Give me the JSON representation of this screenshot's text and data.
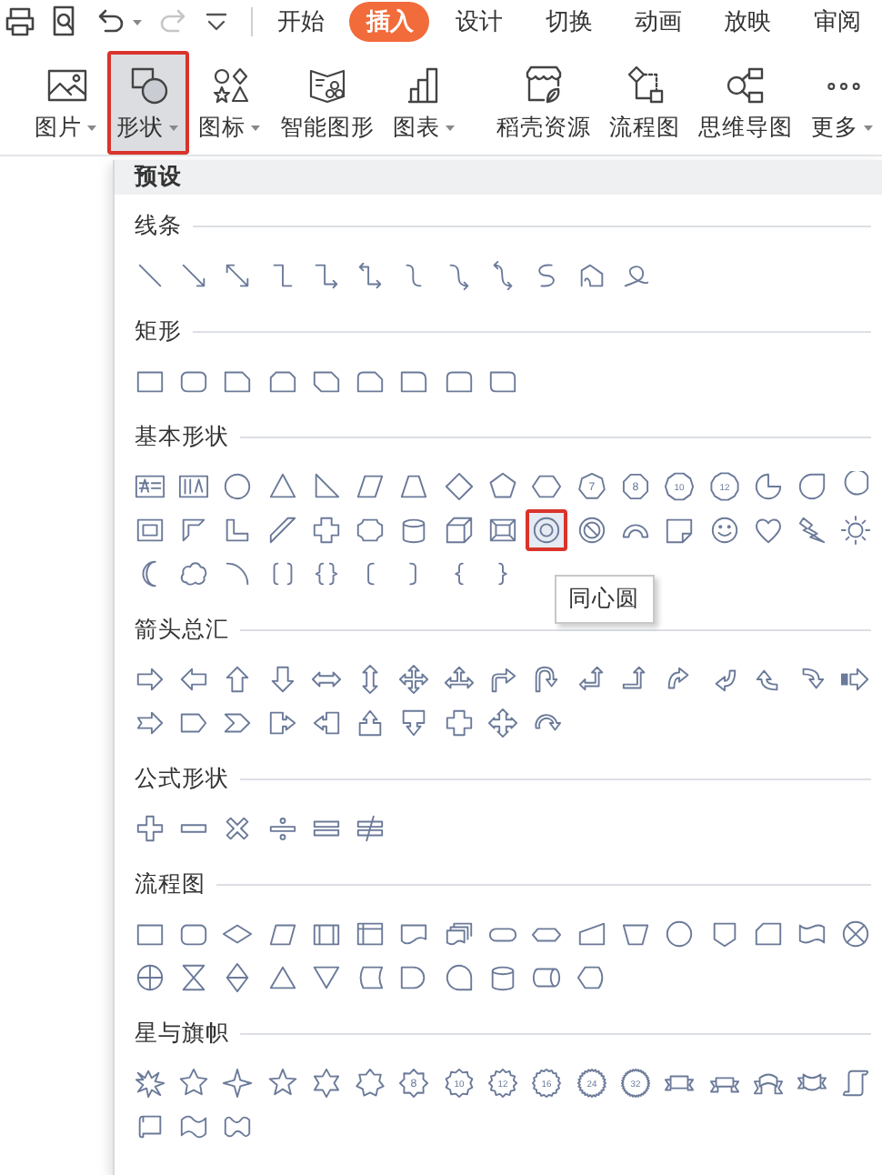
{
  "quick_access": [
    {
      "kind": "print",
      "dropdown": false,
      "disabled": false
    },
    {
      "kind": "print-preview",
      "dropdown": false,
      "disabled": false
    },
    {
      "kind": "undo",
      "dropdown": true,
      "disabled": false
    },
    {
      "kind": "redo",
      "dropdown": false,
      "disabled": true
    },
    {
      "kind": "customize",
      "dropdown": false,
      "disabled": false
    }
  ],
  "tabs": [
    {
      "label": "开始",
      "selected": false
    },
    {
      "label": "插入",
      "selected": true
    },
    {
      "label": "设计",
      "selected": false
    },
    {
      "label": "切换",
      "selected": false
    },
    {
      "label": "动画",
      "selected": false
    },
    {
      "label": "放映",
      "selected": false
    },
    {
      "label": "审阅",
      "selected": false
    }
  ],
  "ribbon": [
    {
      "kind": "picture",
      "label": "图片",
      "dropdown": true,
      "selected": false
    },
    {
      "kind": "shapes",
      "label": "形状",
      "dropdown": true,
      "selected": true
    },
    {
      "kind": "icons",
      "label": "图标",
      "dropdown": true,
      "selected": false
    },
    {
      "kind": "smart-art",
      "label": "智能图形",
      "dropdown": false,
      "selected": false
    },
    {
      "kind": "chart",
      "label": "图表",
      "dropdown": true,
      "selected": false
    },
    {
      "kind": "separator"
    },
    {
      "kind": "store",
      "label": "稻壳资源",
      "dropdown": false,
      "selected": false
    },
    {
      "kind": "flowchart",
      "label": "流程图",
      "dropdown": false,
      "selected": false
    },
    {
      "kind": "mindmap",
      "label": "思维导图",
      "dropdown": false,
      "selected": false
    },
    {
      "kind": "more",
      "label": "更多",
      "dropdown": true,
      "selected": false
    }
  ],
  "gallery": {
    "header": "预设",
    "sections": [
      {
        "title": "线条",
        "shapes": [
          {
            "kind": "line",
            "selected": false
          },
          {
            "kind": "arrow",
            "selected": false
          },
          {
            "kind": "double-arrow",
            "selected": false
          },
          {
            "kind": "elbow-connector",
            "selected": false
          },
          {
            "kind": "elbow-arrow",
            "selected": false
          },
          {
            "kind": "elbow-double-arrow",
            "selected": false
          },
          {
            "kind": "curved-connector",
            "selected": false
          },
          {
            "kind": "curved-arrow",
            "selected": false
          },
          {
            "kind": "curved-double-arrow",
            "selected": false
          },
          {
            "kind": "s-curve",
            "selected": false
          },
          {
            "kind": "freeform",
            "selected": false
          },
          {
            "kind": "scribble",
            "selected": false
          }
        ]
      },
      {
        "title": "矩形",
        "shapes": [
          {
            "kind": "rectangle",
            "selected": false
          },
          {
            "kind": "rounded-rectangle",
            "selected": false
          },
          {
            "kind": "snip-corner",
            "selected": false
          },
          {
            "kind": "snip-same-side",
            "selected": false
          },
          {
            "kind": "snip-diagonal",
            "selected": false
          },
          {
            "kind": "snip-round",
            "selected": false
          },
          {
            "kind": "round-corner",
            "selected": false
          },
          {
            "kind": "round-same-side",
            "selected": false
          },
          {
            "kind": "round-diagonal",
            "selected": false
          }
        ]
      },
      {
        "title": "基本形状",
        "shapes": [
          {
            "kind": "text-box",
            "selected": false
          },
          {
            "kind": "vertical-text-box",
            "selected": false
          },
          {
            "kind": "ellipse",
            "selected": false
          },
          {
            "kind": "triangle",
            "selected": false
          },
          {
            "kind": "right-triangle",
            "selected": false
          },
          {
            "kind": "parallelogram",
            "selected": false
          },
          {
            "kind": "trapezoid",
            "selected": false
          },
          {
            "kind": "diamond",
            "selected": false
          },
          {
            "kind": "pentagon",
            "selected": false
          },
          {
            "kind": "hexagon",
            "selected": false
          },
          {
            "kind": "heptagon",
            "label": "7",
            "selected": false
          },
          {
            "kind": "octagon",
            "label": "8",
            "selected": false
          },
          {
            "kind": "decagon",
            "label": "10",
            "selected": false
          },
          {
            "kind": "dodecagon",
            "label": "12",
            "selected": false
          },
          {
            "kind": "pie",
            "selected": false
          },
          {
            "kind": "teardrop",
            "selected": false
          },
          {
            "kind": "chord",
            "selected": false
          },
          {
            "kind": "frame",
            "selected": false
          },
          {
            "kind": "half-frame",
            "selected": false
          },
          {
            "kind": "l-shape",
            "selected": false
          },
          {
            "kind": "diagonal-stripe",
            "selected": false
          },
          {
            "kind": "cross",
            "selected": false
          },
          {
            "kind": "plaque",
            "selected": false
          },
          {
            "kind": "cylinder",
            "selected": false
          },
          {
            "kind": "cube",
            "selected": false
          },
          {
            "kind": "bevel",
            "selected": false
          },
          {
            "kind": "donut",
            "selected": true
          },
          {
            "kind": "no-symbol",
            "selected": false
          },
          {
            "kind": "block-arc",
            "selected": false
          },
          {
            "kind": "folded-corner",
            "selected": false
          },
          {
            "kind": "smiley",
            "selected": false
          },
          {
            "kind": "heart",
            "selected": false
          },
          {
            "kind": "lightning",
            "selected": false
          },
          {
            "kind": "sun",
            "selected": false
          },
          {
            "kind": "moon",
            "selected": false
          },
          {
            "kind": "cloud",
            "selected": false
          },
          {
            "kind": "arc",
            "selected": false
          },
          {
            "kind": "bracket-pair",
            "selected": false
          },
          {
            "kind": "brace-pair",
            "selected": false
          },
          {
            "kind": "left-bracket",
            "selected": false
          },
          {
            "kind": "right-bracket",
            "selected": false
          },
          {
            "kind": "left-brace",
            "selected": false
          },
          {
            "kind": "right-brace",
            "selected": false
          }
        ]
      },
      {
        "title": "箭头总汇",
        "shapes": [
          {
            "kind": "right-arrow",
            "selected": false
          },
          {
            "kind": "left-arrow",
            "selected": false
          },
          {
            "kind": "up-arrow",
            "selected": false
          },
          {
            "kind": "down-arrow",
            "selected": false
          },
          {
            "kind": "left-right-arrow",
            "selected": false
          },
          {
            "kind": "up-down-arrow",
            "selected": false
          },
          {
            "kind": "quad-arrow",
            "selected": false
          },
          {
            "kind": "left-right-up-arrow",
            "selected": false
          },
          {
            "kind": "bent-arrow",
            "selected": false
          },
          {
            "kind": "u-turn-arrow",
            "selected": false
          },
          {
            "kind": "left-up-arrow",
            "selected": false
          },
          {
            "kind": "bent-up-arrow",
            "selected": false
          },
          {
            "kind": "curved-right-arrow",
            "selected": false
          },
          {
            "kind": "curved-left-arrow",
            "selected": false
          },
          {
            "kind": "curved-up-arrow",
            "selected": false
          },
          {
            "kind": "curved-down-arrow",
            "selected": false
          },
          {
            "kind": "striped-right-arrow",
            "selected": false
          },
          {
            "kind": "notched-right-arrow",
            "selected": false
          },
          {
            "kind": "pentagon-arrow",
            "selected": false
          },
          {
            "kind": "chevron",
            "selected": false
          },
          {
            "kind": "right-arrow-callout",
            "selected": false
          },
          {
            "kind": "left-arrow-callout",
            "selected": false
          },
          {
            "kind": "up-arrow-callout",
            "selected": false
          },
          {
            "kind": "down-arrow-callout",
            "selected": false
          },
          {
            "kind": "quad-arrow-callout",
            "selected": false
          },
          {
            "kind": "four-way-arrow",
            "selected": false
          },
          {
            "kind": "circular-arrow",
            "selected": false
          }
        ]
      },
      {
        "title": "公式形状",
        "shapes": [
          {
            "kind": "plus",
            "selected": false
          },
          {
            "kind": "minus",
            "selected": false
          },
          {
            "kind": "multiply",
            "selected": false
          },
          {
            "kind": "divide",
            "selected": false
          },
          {
            "kind": "equal",
            "selected": false
          },
          {
            "kind": "not-equal",
            "selected": false
          }
        ]
      },
      {
        "title": "流程图",
        "shapes": [
          {
            "kind": "process",
            "selected": false
          },
          {
            "kind": "alternate-process",
            "selected": false
          },
          {
            "kind": "decision",
            "selected": false
          },
          {
            "kind": "data",
            "selected": false
          },
          {
            "kind": "predefined-process",
            "selected": false
          },
          {
            "kind": "internal-storage",
            "selected": false
          },
          {
            "kind": "document",
            "selected": false
          },
          {
            "kind": "multi-document",
            "selected": false
          },
          {
            "kind": "terminator",
            "selected": false
          },
          {
            "kind": "preparation",
            "selected": false
          },
          {
            "kind": "manual-input",
            "selected": false
          },
          {
            "kind": "manual-operation",
            "selected": false
          },
          {
            "kind": "connector",
            "selected": false
          },
          {
            "kind": "off-page-connector",
            "selected": false
          },
          {
            "kind": "card",
            "selected": false
          },
          {
            "kind": "punched-tape",
            "selected": false
          },
          {
            "kind": "summing-junction",
            "selected": false
          },
          {
            "kind": "or",
            "selected": false
          },
          {
            "kind": "collate",
            "selected": false
          },
          {
            "kind": "sort",
            "selected": false
          },
          {
            "kind": "extract",
            "selected": false
          },
          {
            "kind": "merge",
            "selected": false
          },
          {
            "kind": "stored-data",
            "selected": false
          },
          {
            "kind": "delay",
            "selected": false
          },
          {
            "kind": "sequential-access",
            "selected": false
          },
          {
            "kind": "magnetic-disk",
            "selected": false
          },
          {
            "kind": "direct-access",
            "selected": false
          },
          {
            "kind": "display",
            "selected": false
          }
        ]
      },
      {
        "title": "星与旗帜",
        "shapes": [
          {
            "kind": "explosion",
            "selected": false
          },
          {
            "kind": "explosion-outline",
            "selected": false
          },
          {
            "kind": "star-4",
            "selected": false
          },
          {
            "kind": "star-5",
            "selected": false
          },
          {
            "kind": "star-6",
            "selected": false
          },
          {
            "kind": "star-7",
            "selected": false
          },
          {
            "kind": "star-8",
            "label": "8",
            "selected": false
          },
          {
            "kind": "star-10",
            "label": "10",
            "selected": false
          },
          {
            "kind": "star-12",
            "label": "12",
            "selected": false
          },
          {
            "kind": "star-16",
            "label": "16",
            "selected": false
          },
          {
            "kind": "star-24",
            "label": "24",
            "selected": false
          },
          {
            "kind": "star-32",
            "label": "32",
            "selected": false
          },
          {
            "kind": "ribbon-down",
            "selected": false
          },
          {
            "kind": "ribbon-up",
            "selected": false
          },
          {
            "kind": "curved-ribbon-down",
            "selected": false
          },
          {
            "kind": "curved-ribbon-up",
            "selected": false
          },
          {
            "kind": "vertical-scroll",
            "selected": false
          },
          {
            "kind": "horizontal-scroll",
            "selected": false
          },
          {
            "kind": "wave",
            "selected": false
          },
          {
            "kind": "double-wave",
            "selected": false
          }
        ]
      }
    ]
  },
  "tooltip": {
    "text": "同心圆"
  }
}
